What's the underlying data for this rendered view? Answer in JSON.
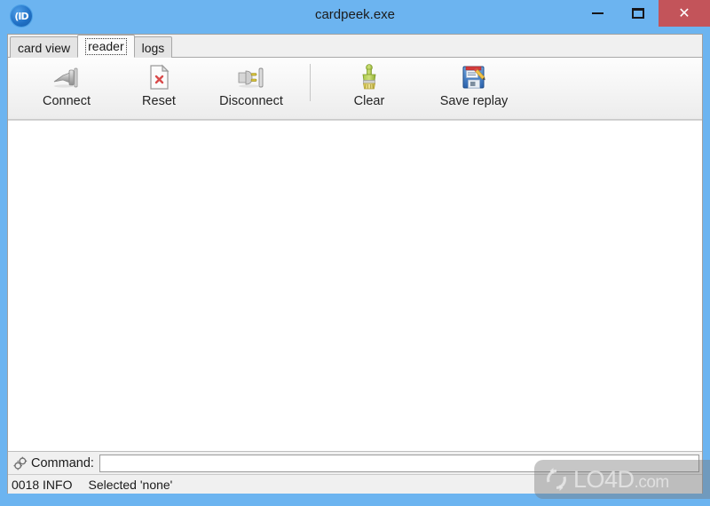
{
  "window": {
    "title": "cardpeek.exe",
    "app_icon": "cardpeek-app-icon",
    "accent_color": "#6cb4f0",
    "close_color": "#c3545a",
    "controls": {
      "minimize": "minimize-icon",
      "maximize": "restore-icon",
      "close": "✕"
    }
  },
  "tabs": [
    {
      "label": "card view",
      "active": false
    },
    {
      "label": "reader",
      "active": true
    },
    {
      "label": "logs",
      "active": false
    }
  ],
  "toolbar": {
    "items": [
      {
        "label": "Connect",
        "icon": "plug-connect-icon"
      },
      {
        "label": "Reset",
        "icon": "document-error-icon"
      },
      {
        "label": "Disconnect",
        "icon": "plug-disconnect-icon"
      },
      {
        "label": "Clear",
        "icon": "paintbrush-icon"
      },
      {
        "label": "Save replay",
        "icon": "floppy-save-icon"
      }
    ]
  },
  "command": {
    "icon": "gear-icon",
    "label": "Command:",
    "value": "",
    "placeholder": ""
  },
  "status": {
    "code": "0018 INFO",
    "message": "Selected 'none'"
  },
  "watermark": {
    "logo": "lo4d-refresh-logo",
    "name": "LO4D",
    "suffix": ".com"
  }
}
